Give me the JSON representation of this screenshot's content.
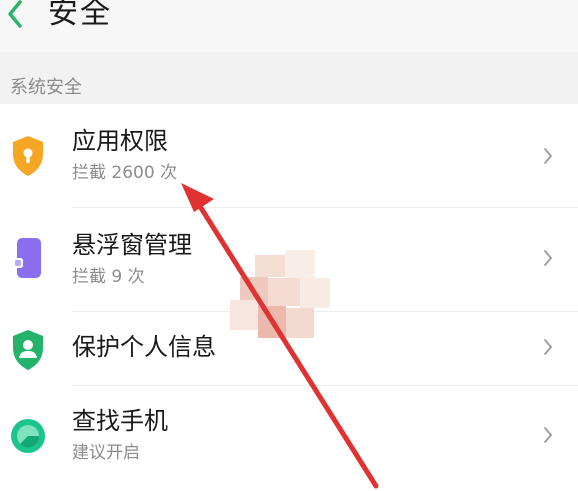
{
  "header": {
    "title": "安全",
    "back_icon": "chevron-left-icon",
    "back_color": "#2bb36b"
  },
  "section": {
    "label": "系统安全"
  },
  "items": [
    {
      "title": "应用权限",
      "subtitle": "拦截 2600 次",
      "icon": "shield-lock-icon",
      "icon_color": "#f5a623"
    },
    {
      "title": "悬浮窗管理",
      "subtitle": "拦截 9 次",
      "icon": "floating-window-icon",
      "icon_color": "#8b6ff0"
    },
    {
      "title": "保护个人信息",
      "subtitle": "",
      "icon": "shield-person-icon",
      "icon_color": "#23b36b"
    },
    {
      "title": "查找手机",
      "subtitle": "建议开启",
      "icon": "find-phone-icon",
      "icon_color": "#1dc38d"
    }
  ],
  "annotation": {
    "color": "#e03232"
  }
}
